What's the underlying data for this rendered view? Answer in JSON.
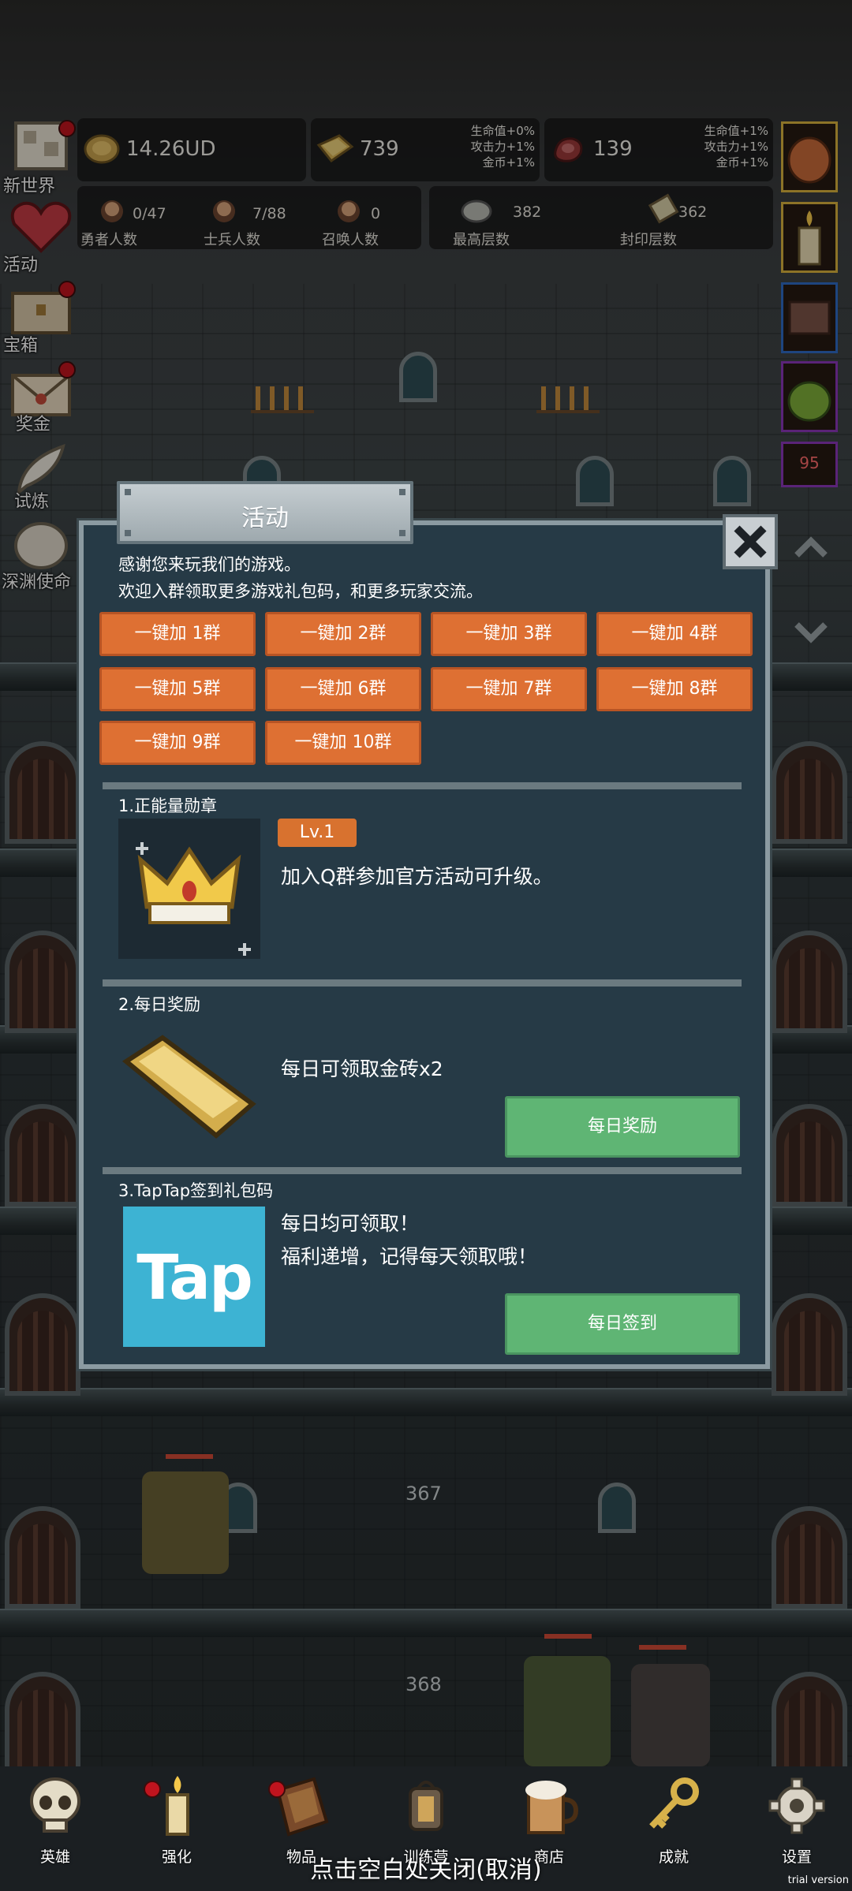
{
  "resources": {
    "coins": {
      "value": "14.26UD",
      "icon": "gold-coin-icon"
    },
    "gold_bricks": {
      "value": "739",
      "bonus": [
        "生命值+0%",
        "攻击力+1%",
        "金币+1%"
      ],
      "icon": "gold-brick-icon"
    },
    "meat": {
      "value": "139",
      "bonus": [
        "生命值+1%",
        "攻击力+1%",
        "金币+1%"
      ],
      "icon": "meat-icon"
    }
  },
  "stats": [
    {
      "value": "0/47",
      "label": "勇者人数"
    },
    {
      "value": "7/88",
      "label": "士兵人数"
    },
    {
      "value": "0",
      "label": "召唤人数"
    },
    {
      "value": "382",
      "label": "最高层数"
    },
    {
      "value": "362",
      "label": "封印层数"
    }
  ],
  "side_menu": [
    {
      "label": "新世界",
      "icon": "new-world-icon",
      "badge": true
    },
    {
      "label": "活动",
      "icon": "heart-icon",
      "badge": false
    },
    {
      "label": "宝箱",
      "icon": "chest-icon",
      "badge": true
    },
    {
      "label": "奖金",
      "icon": "envelope-icon",
      "badge": true
    },
    {
      "label": "试炼",
      "icon": "feather-icon",
      "badge": false
    },
    {
      "label": "深渊使命",
      "icon": "orb-icon",
      "badge": false
    }
  ],
  "right_menu": {
    "timer": "95",
    "icons": [
      "onion-icon",
      "candle-icon",
      "meat-scroll-icon",
      "slime-icon",
      "timer-icon"
    ]
  },
  "floors": [
    "367",
    "368"
  ],
  "modal": {
    "title": "活动",
    "intro_line1": "感谢您来玩我们的游戏。",
    "intro_line2": "欢迎入群领取更多游戏礼包码，和更多玩家交流。",
    "group_buttons": [
      "一键加 1群",
      "一键加 2群",
      "一键加 3群",
      "一键加 4群",
      "一键加 5群",
      "一键加 6群",
      "一键加 7群",
      "一键加 8群",
      "一键加 9群",
      "一键加 10群"
    ],
    "section1": {
      "title": "1.正能量勋章",
      "level": "Lv.1",
      "desc": "加入Q群参加官方活动可升级。",
      "icon": "crown-icon"
    },
    "section2": {
      "title": "2.每日奖励",
      "desc": "每日可领取金砖x2",
      "button": "每日奖励",
      "icon": "gold-brick-icon"
    },
    "section3": {
      "title": "3.TapTap签到礼包码",
      "desc_line1": "每日均可领取！",
      "desc_line2": "福利递增，记得每天领取哦！",
      "button": "每日签到",
      "logo_text": "Tap"
    }
  },
  "bottom_nav": [
    {
      "label": "英雄",
      "icon": "skull-icon",
      "badge": false
    },
    {
      "label": "强化",
      "icon": "candle-icon",
      "badge": true
    },
    {
      "label": "物品",
      "icon": "book-icon",
      "badge": true
    },
    {
      "label": "训练营",
      "icon": "lantern-icon",
      "badge": false
    },
    {
      "label": "商店",
      "icon": "beer-mug-icon",
      "badge": false
    },
    {
      "label": "成就",
      "icon": "key-icon",
      "badge": false
    },
    {
      "label": "设置",
      "icon": "gear-icon",
      "badge": false
    }
  ],
  "close_hint": "点击空白处关闭(取消)",
  "watermark": "trial version"
}
